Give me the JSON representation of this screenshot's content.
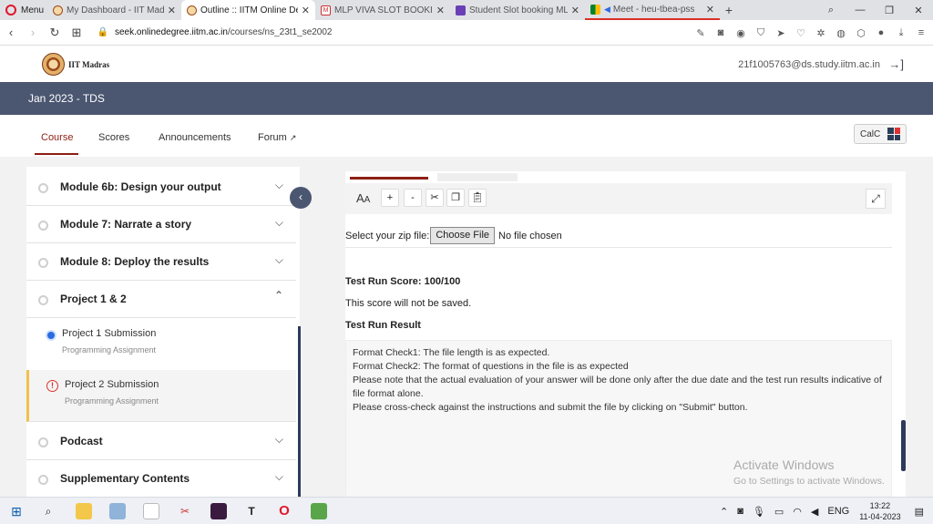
{
  "browser": {
    "menu_label": "Menu",
    "tabs": [
      {
        "title": "My Dashboard - IIT Madras",
        "active": false
      },
      {
        "title": "Outline :: IITM Online Degree",
        "active": true
      },
      {
        "title": "MLP VIVA SLOT BOOKING",
        "active": false
      },
      {
        "title": "Student Slot booking MLP",
        "active": false
      },
      {
        "title": "Meet - heu-tbea-pss",
        "active": false
      }
    ],
    "url_host": "seek.onlinedegree.iitm.ac.in",
    "url_path": "/courses/ns_23t1_se2002"
  },
  "site": {
    "logo_text": "IIT Madras",
    "user_email": "21f1005763@ds.study.iitm.ac.in",
    "course_title": "Jan 2023 - TDS"
  },
  "nav": {
    "tabs": [
      "Course",
      "Scores",
      "Announcements",
      "Forum"
    ],
    "active": "Course",
    "calc_label": "CalC"
  },
  "sidebar": {
    "modules": [
      {
        "title": "Module 6b: Design your output",
        "expanded": false
      },
      {
        "title": "Module 7: Narrate a story",
        "expanded": false
      },
      {
        "title": "Module 8: Deploy the results",
        "expanded": false
      },
      {
        "title": "Project 1 & 2",
        "expanded": true
      },
      {
        "title": "Podcast",
        "expanded": false
      },
      {
        "title": "Supplementary Contents",
        "expanded": false
      }
    ],
    "project_items": [
      {
        "title": "Project 1 Submission",
        "type": "Programming Assignment",
        "status": "completed"
      },
      {
        "title": "Project 2 Submission",
        "type": "Programming Assignment",
        "status": "warning"
      }
    ]
  },
  "main": {
    "toolbar_font_label": "AA",
    "file_label": "Select your zip file:",
    "choose_file": "Choose File",
    "no_file": "No file chosen",
    "score": "Test Run Score: 100/100",
    "not_saved": "This score will not be saved.",
    "result_heading": "Test Run Result",
    "result_lines": [
      "Format Check1: The file length is as expected.",
      "Format Check2: The format of questions in the file is as expected",
      "Please note that the actual evaluation of your answer will be done only after the due date and the test run results indicative of file format alone.",
      "Please cross-check against the instructions and submit the file by clicking on \"Submit\" button."
    ],
    "watermark_title": "Activate Windows",
    "watermark_sub": "Go to Settings to activate Windows."
  },
  "taskbar": {
    "language": "ENG",
    "time": "13:22",
    "date": "11-04-2023"
  }
}
